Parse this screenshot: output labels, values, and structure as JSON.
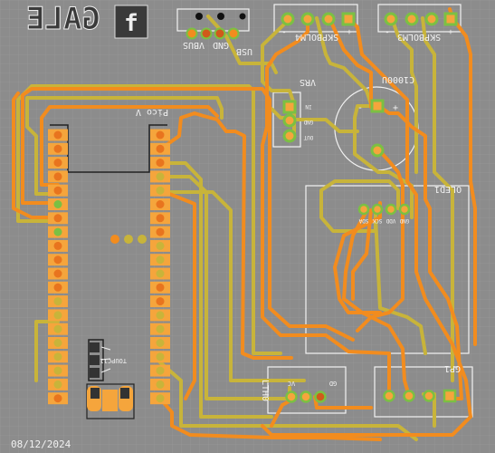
{
  "logo": {
    "text": "GALE",
    "icon": "gale-f-logo-icon"
  },
  "date": "08/12/2024",
  "usb_header": {
    "labels": [
      "VBUS",
      "GND",
      "USB"
    ]
  },
  "speaker4": {
    "label": "SKPBOLM4",
    "signs": [
      "+",
      "-"
    ]
  },
  "speaker3": {
    "label": "SKPBOLM3",
    "signs": [
      "+",
      "-"
    ]
  },
  "vrs": {
    "label": "VRS",
    "pins": [
      "IN",
      "GND",
      "OUT"
    ]
  },
  "capacitor": {
    "label": "C1000U",
    "signs": [
      "-",
      "+"
    ]
  },
  "pico": {
    "label": "Pico V"
  },
  "oled": {
    "label": "OLED1",
    "pins": [
      "SDA",
      "SCK",
      "VDD",
      "GND"
    ]
  },
  "ldr": {
    "label": "LTH0",
    "pins": [
      "VC",
      "GD"
    ]
  },
  "gp": {
    "label": "GP1"
  },
  "tag": "TOUPC11",
  "colors": {
    "background": "#8c8c8c",
    "grid": "#999999",
    "trace_orange": "#f28c1e",
    "trace_yellow": "#c8b43a",
    "pad_orange": "#f5a53c",
    "via_green": "#7bc043",
    "silk": "#f2f2f2"
  }
}
